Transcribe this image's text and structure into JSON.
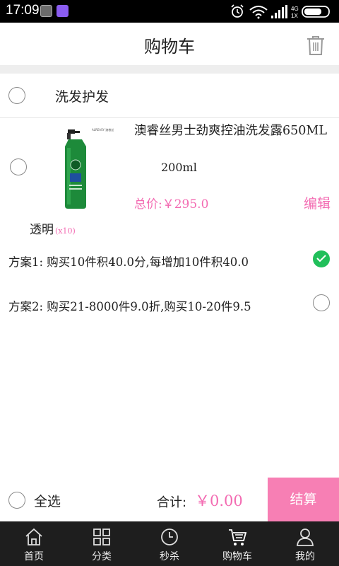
{
  "status_bar": {
    "time": "17:09",
    "network": "4G",
    "network_sub": "1X"
  },
  "header": {
    "title": "购物车"
  },
  "store": {
    "name": "洗发护发"
  },
  "product": {
    "name": "澳睿丝男士劲爽控油洗发露650ML",
    "spec": "200ml",
    "total_label": "总价:",
    "total_value": "￥295.0",
    "edit_label": "编辑",
    "attr": "透明",
    "qty": "(x10)"
  },
  "schemes": [
    {
      "text": "方案1: 购买10件积40.0分,每增加10件积40.0",
      "checked": true
    },
    {
      "text": "方案2: 购买21-8000件9.0折,购买10-20件9.5",
      "checked": false
    }
  ],
  "footer": {
    "select_all_label": "全选",
    "sum_label": "合计:",
    "sum_value": "￥0.00",
    "checkout_label": "结算"
  },
  "tabs": [
    {
      "label": "首页",
      "icon": "home-icon"
    },
    {
      "label": "分类",
      "icon": "grid-icon"
    },
    {
      "label": "秒杀",
      "icon": "clock-icon"
    },
    {
      "label": "购物车",
      "icon": "cart-icon"
    },
    {
      "label": "我的",
      "icon": "user-icon"
    }
  ],
  "colors": {
    "accent_pink": "#f36bb2",
    "checkout_bg": "#f77fb4",
    "check_green": "#21bf5a",
    "tabbar_bg": "#1e1e1e"
  }
}
